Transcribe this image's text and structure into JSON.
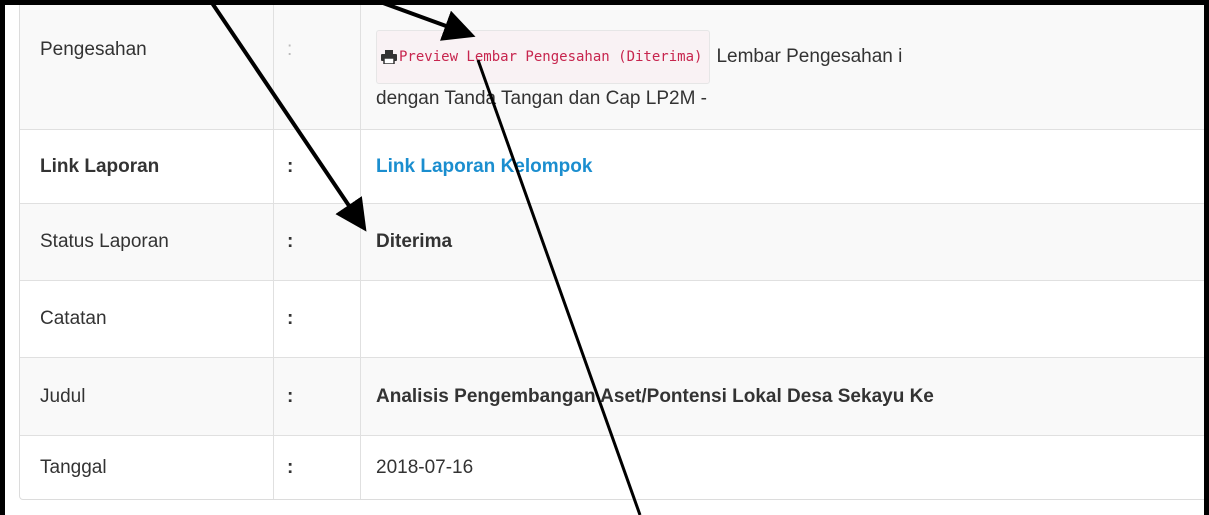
{
  "table": {
    "rows": [
      {
        "label": "Pengesahan",
        "sep": ":",
        "button_label": "Preview Lembar Pengesahan (Diterima)",
        "value_after_button": "Lembar Pengesahan i",
        "value_line2": "dengan Tanda Tangan dan Cap LP2M -"
      },
      {
        "label": "Link Laporan",
        "sep": ":",
        "value": "Link Laporan Kelompok"
      },
      {
        "label": "Status Laporan",
        "sep": ":",
        "value": "Diterima"
      },
      {
        "label": "Catatan",
        "sep": ":",
        "value": ""
      },
      {
        "label": "Judul",
        "sep": ":",
        "value": "Analisis Pengembangan Aset/Pontensi Lokal Desa Sekayu Ke"
      },
      {
        "label": "Tanggal",
        "sep": ":",
        "value": "2018-07-16"
      }
    ]
  },
  "icons": {
    "print": "printer-icon"
  },
  "colors": {
    "link": "#1b8ecf",
    "code_text": "#c7254e",
    "code_bg": "#f9f2f4"
  }
}
